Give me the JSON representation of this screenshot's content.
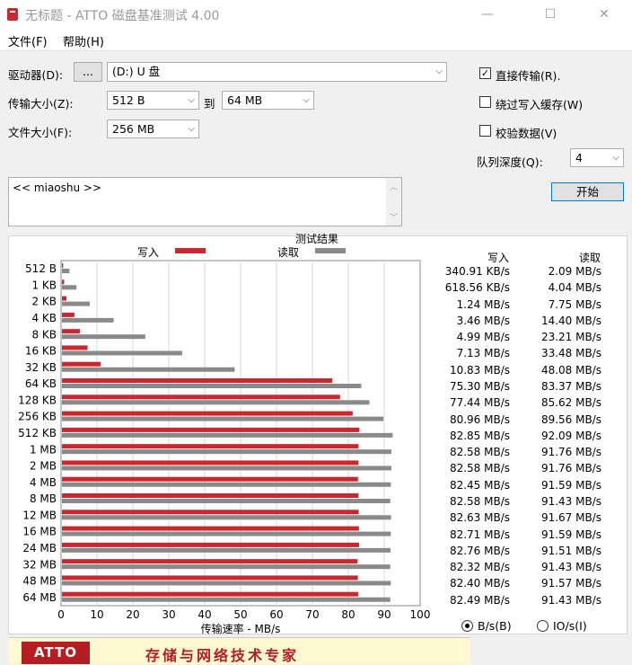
{
  "window": {
    "title": "无标题 - ATTO 磁盘基准测试 4.00",
    "controls": {
      "minimize": "—",
      "maximize": "☐",
      "close": "✕"
    }
  },
  "menu": {
    "items": [
      "文件(F)",
      "帮助(H)"
    ]
  },
  "settings": {
    "drive_label": "驱动器(D):",
    "browse_label": "...",
    "drive_value": "(D:) U 盘",
    "transfer_size_label": "传输大小(Z):",
    "transfer_from": "512 B",
    "to_label": "到",
    "transfer_to": "64 MB",
    "file_size_label": "文件大小(F):",
    "file_size": "256 MB",
    "direct_io_label": "直接传输(R).",
    "direct_io_checked": true,
    "bypass_cache_label": "绕过写入缓存(W)",
    "bypass_cache_checked": false,
    "verify_label": "校验数据(V)",
    "verify_checked": false,
    "queue_depth_label": "队列深度(Q):",
    "queue_depth": "4",
    "start_label": "开始",
    "description": "<< miaoshu >>"
  },
  "results": {
    "section_title": "测试结果",
    "write_legend": "写入",
    "read_legend": "读取",
    "write_header": "写入",
    "read_header": "读取",
    "write_color": "#c8282e",
    "read_color": "#8a8a8a",
    "unit_bytes_label": "B/s(B)",
    "unit_io_label": "IO/s(I)",
    "unit_selected": "B/s",
    "write_values": [
      "340.91 KB/s",
      "618.56 KB/s",
      "1.24 MB/s",
      "3.46 MB/s",
      "4.99 MB/s",
      "7.13 MB/s",
      "10.83 MB/s",
      "75.30 MB/s",
      "77.44 MB/s",
      "80.96 MB/s",
      "82.85 MB/s",
      "82.58 MB/s",
      "82.58 MB/s",
      "82.45 MB/s",
      "82.58 MB/s",
      "82.63 MB/s",
      "82.71 MB/s",
      "82.76 MB/s",
      "82.32 MB/s",
      "82.40 MB/s",
      "82.49 MB/s"
    ],
    "read_values": [
      "2.09 MB/s",
      "4.04 MB/s",
      "7.75 MB/s",
      "14.40 MB/s",
      "23.21 MB/s",
      "33.48 MB/s",
      "48.08 MB/s",
      "83.37 MB/s",
      "85.62 MB/s",
      "89.56 MB/s",
      "92.09 MB/s",
      "91.76 MB/s",
      "91.76 MB/s",
      "91.59 MB/s",
      "91.43 MB/s",
      "91.67 MB/s",
      "91.59 MB/s",
      "91.51 MB/s",
      "91.43 MB/s",
      "91.57 MB/s",
      "91.43 MB/s"
    ]
  },
  "chart_data": {
    "type": "bar",
    "orientation": "horizontal",
    "xlabel": "传输速率 - MB/s",
    "xlim": [
      0,
      100
    ],
    "xticks": [
      0,
      10,
      20,
      30,
      40,
      50,
      60,
      70,
      80,
      90,
      100
    ],
    "grid": true,
    "categories": [
      "512 B",
      "1 KB",
      "2 KB",
      "4 KB",
      "8 KB",
      "16 KB",
      "32 KB",
      "64 KB",
      "128 KB",
      "256 KB",
      "512 KB",
      "1 MB",
      "2 MB",
      "4 MB",
      "8 MB",
      "12 MB",
      "16 MB",
      "24 MB",
      "32 MB",
      "48 MB",
      "64 MB"
    ],
    "series": [
      {
        "name": "写入",
        "values": [
          0.33,
          0.6,
          1.24,
          3.46,
          4.99,
          7.13,
          10.83,
          75.3,
          77.44,
          80.96,
          82.85,
          82.58,
          82.58,
          82.45,
          82.58,
          82.63,
          82.71,
          82.76,
          82.32,
          82.4,
          82.49
        ]
      },
      {
        "name": "读取",
        "values": [
          2.09,
          4.04,
          7.75,
          14.4,
          23.21,
          33.48,
          48.08,
          83.37,
          85.62,
          89.56,
          92.09,
          91.76,
          91.76,
          91.59,
          91.43,
          91.67,
          91.59,
          91.51,
          91.43,
          91.57,
          91.43
        ]
      }
    ]
  },
  "banner": {
    "logo": "ATTO",
    "slogan": "存储与网络技术专家"
  }
}
